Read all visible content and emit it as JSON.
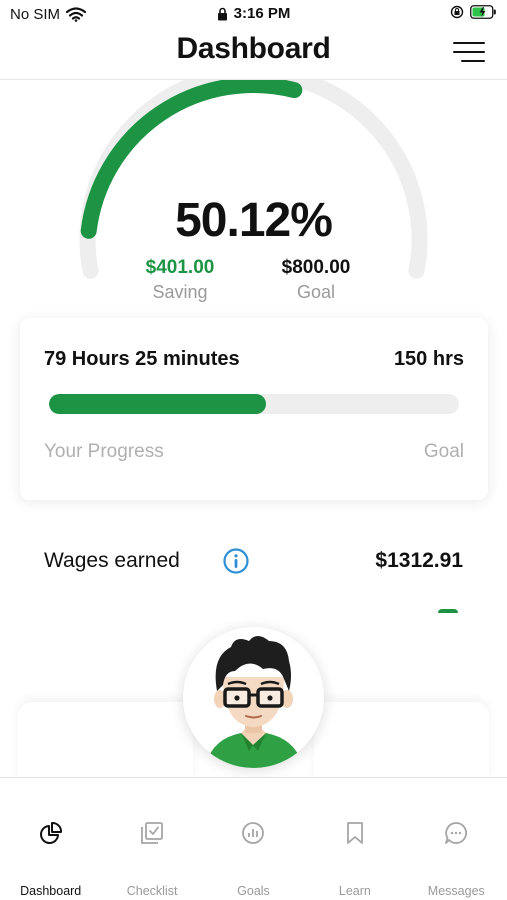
{
  "status_bar": {
    "carrier": "No SIM",
    "time": "3:16 PM"
  },
  "header": {
    "title": "Dashboard"
  },
  "gauge": {
    "percent_text": "50.12%",
    "progress_fraction": 0.5012,
    "saving_value": "$401.00",
    "saving_label": "Saving",
    "goal_value": "$800.00",
    "goal_label": "Goal"
  },
  "progress_card": {
    "hours_text": "79 Hours 25 minutes",
    "goal_text": "150 hrs",
    "progress_fraction": 0.53,
    "left_label": "Your Progress",
    "right_label": "Goal"
  },
  "wages": {
    "label": "Wages earned",
    "value": "$1312.91"
  },
  "colors": {
    "accent": "#1c9444",
    "track": "#eeeeee",
    "muted_text": "#9a9a9a",
    "info_blue": "#2d8fd6"
  },
  "tabs": [
    {
      "label": "Dashboard",
      "icon": "pie-chart-icon",
      "active": true
    },
    {
      "label": "Checklist",
      "icon": "checklist-icon",
      "active": false
    },
    {
      "label": "Goals",
      "icon": "goals-chart-icon",
      "active": false
    },
    {
      "label": "Learn",
      "icon": "bookmark-icon",
      "active": false
    },
    {
      "label": "Messages",
      "icon": "chat-bubble-icon",
      "active": false
    }
  ]
}
